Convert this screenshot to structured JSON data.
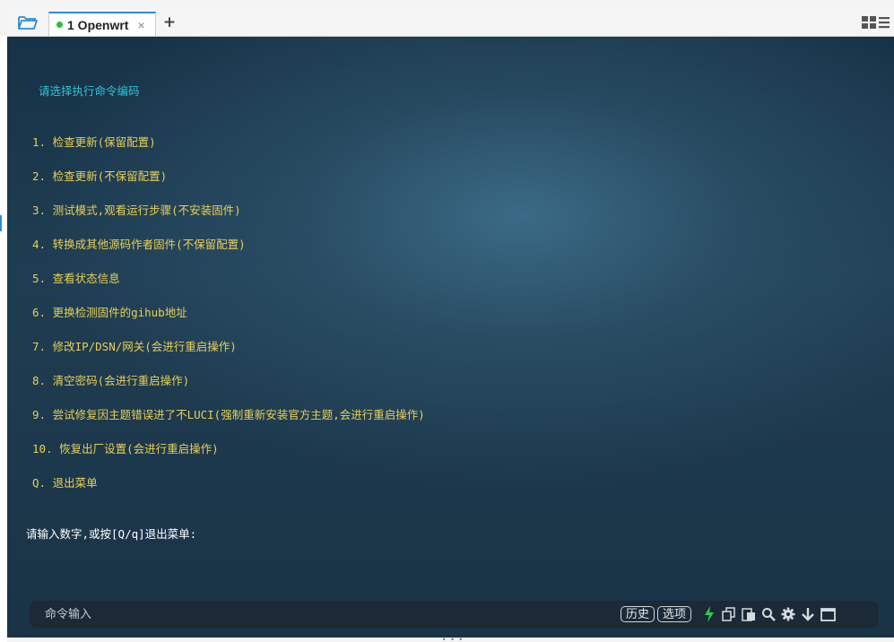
{
  "tabs": [
    {
      "label": "1 Openwrt",
      "status_color": "#2bbf3a",
      "active": true
    }
  ],
  "icons": {
    "open_folder": "folder-open-icon",
    "add_tab": "plus-icon",
    "layout": "grid-layout-icon"
  },
  "terminal": {
    "title": "请选择执行命令编码",
    "menu": [
      "1. 检查更新(保留配置)",
      "2. 检查更新(不保留配置)",
      "3. 测试模式,观看运行步骤(不安装固件)",
      "4. 转换成其他源码作者固件(不保留配置)",
      "5. 查看状态信息",
      "6. 更换检测固件的gihub地址",
      "7. 修改IP/DSN/网关(会进行重启操作)",
      "8. 清空密码(会进行重启操作)",
      "9. 尝试修复因主题错误进了不LUCI(强制重新安装官方主题,会进行重启操作)",
      "10. 恢复出厂设置(会进行重启操作)",
      "Q. 退出菜单"
    ],
    "prompt": "请输入数字,或按[Q/q]退出菜单:",
    "colors": {
      "title": "#2fc3d6",
      "menu": "#e9cf55",
      "prompt": "#ffffff"
    }
  },
  "command_bar": {
    "placeholder": "命令输入",
    "history_label": "历史",
    "options_label": "选项",
    "tool_icons": [
      "bolt-icon",
      "copy-icon",
      "paste-icon",
      "search-icon",
      "gear-icon",
      "arrow-down-icon",
      "window-icon"
    ],
    "bolt_color": "#2bd14a"
  }
}
